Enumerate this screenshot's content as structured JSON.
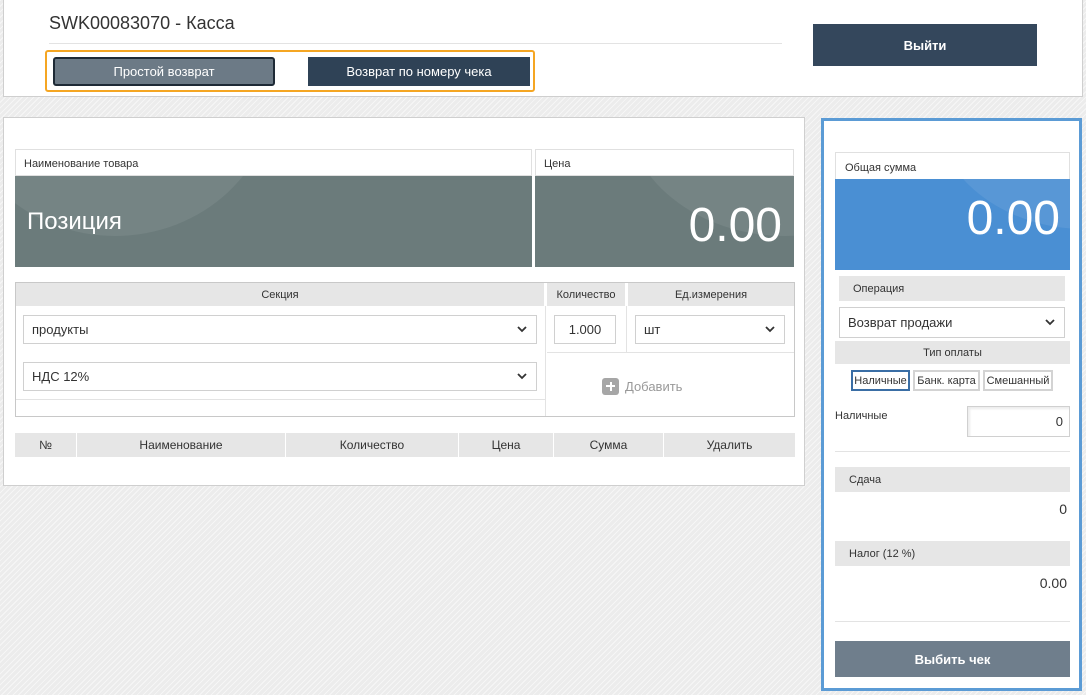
{
  "header": {
    "title": "SWK00083070 - Касса",
    "tabs": [
      {
        "label": "Простой возврат",
        "active": true
      },
      {
        "label": "Возврат по номеру чека",
        "active": false
      }
    ],
    "logout_label": "Выйти"
  },
  "product": {
    "name_label": "Наименование товара",
    "name_value": "Позиция",
    "price_label": "Цена",
    "price_value": "0.00"
  },
  "form": {
    "section_label": "Секция",
    "section_value": "продукты",
    "quantity_label": "Количество",
    "quantity_value": "1.000",
    "unit_label": "Ед.измерения",
    "unit_value": "шт",
    "vat_value": "НДС 12%",
    "add_label": "Добавить"
  },
  "table": {
    "columns": [
      "№",
      "Наименование",
      "Количество",
      "Цена",
      "Сумма",
      "Удалить"
    ],
    "rows": []
  },
  "summary": {
    "total_label": "Общая сумма",
    "total_value": "0.00",
    "operation_label": "Операция",
    "operation_value": "Возврат продажи",
    "payment_type_label": "Тип оплаты",
    "payment_types": [
      "Наличные",
      "Банк. карта",
      "Смешанный"
    ],
    "payment_type_selected": "Наличные",
    "cash_label": "Наличные",
    "cash_value": "0",
    "change_label": "Сдача",
    "change_value": "0",
    "tax_label": "Налог (12 %)",
    "tax_value": "0.00",
    "print_label": "Выбить чек"
  },
  "colors": {
    "accent_orange": "#f5a623",
    "dark_button": "#34475c",
    "blue_panel": "#4a8fd3",
    "panel_border": "#5b9bd5",
    "grey_box": "#6b7b7b"
  }
}
